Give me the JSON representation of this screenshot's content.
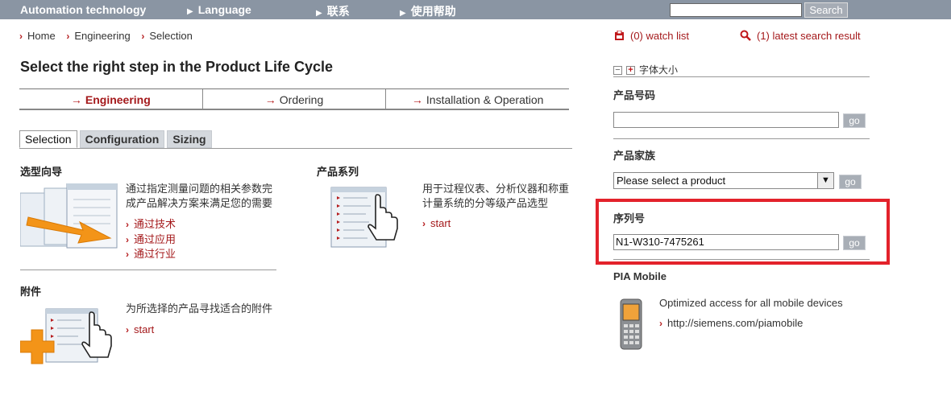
{
  "topbar": {
    "brand": "Automation technology",
    "language": "Language",
    "contact": "联系",
    "help": "使用帮助",
    "search_value": "",
    "search_button": "Search"
  },
  "breadcrumb": [
    "Home",
    "Engineering",
    "Selection"
  ],
  "page_title": "Select the right step in the Product Life Cycle",
  "lifecycle": {
    "items": [
      "Engineering",
      "Ordering",
      "Installation & Operation"
    ]
  },
  "tabs": [
    "Selection",
    "Configuration",
    "Sizing"
  ],
  "sections": {
    "wizard": {
      "title": "选型向导",
      "description": "通过指定测量问题的相关参数完成产品解决方案来满足您的需要",
      "links": [
        "通过技术",
        "通过应用",
        "通过行业"
      ]
    },
    "family": {
      "title": "产品系列",
      "description": "用于过程仪表、分析仪器和称重计量系统的分等级产品选型",
      "link": "start"
    },
    "accessories": {
      "title": "附件",
      "description": "为所选择的产品寻找适合的附件",
      "link": "start"
    }
  },
  "right": {
    "watch_list": "(0) watch list",
    "latest_search": "(1) latest search result",
    "font_size": "字体大小",
    "product_code": {
      "label": "产品号码",
      "value": "",
      "go": "go"
    },
    "product_family": {
      "label": "产品家族",
      "selected": "Please select a product",
      "go": "go"
    },
    "serial": {
      "label": "序列号",
      "value": "N1-W310-7475261",
      "go": "go"
    },
    "mobile": {
      "title": "PIA Mobile",
      "description": "Optimized access for all mobile devices",
      "link": "http://siemens.com/piamobile"
    }
  },
  "colors": {
    "topbar": "#8a95a3",
    "link_red": "#a4191b",
    "highlight": "#e3222b"
  }
}
